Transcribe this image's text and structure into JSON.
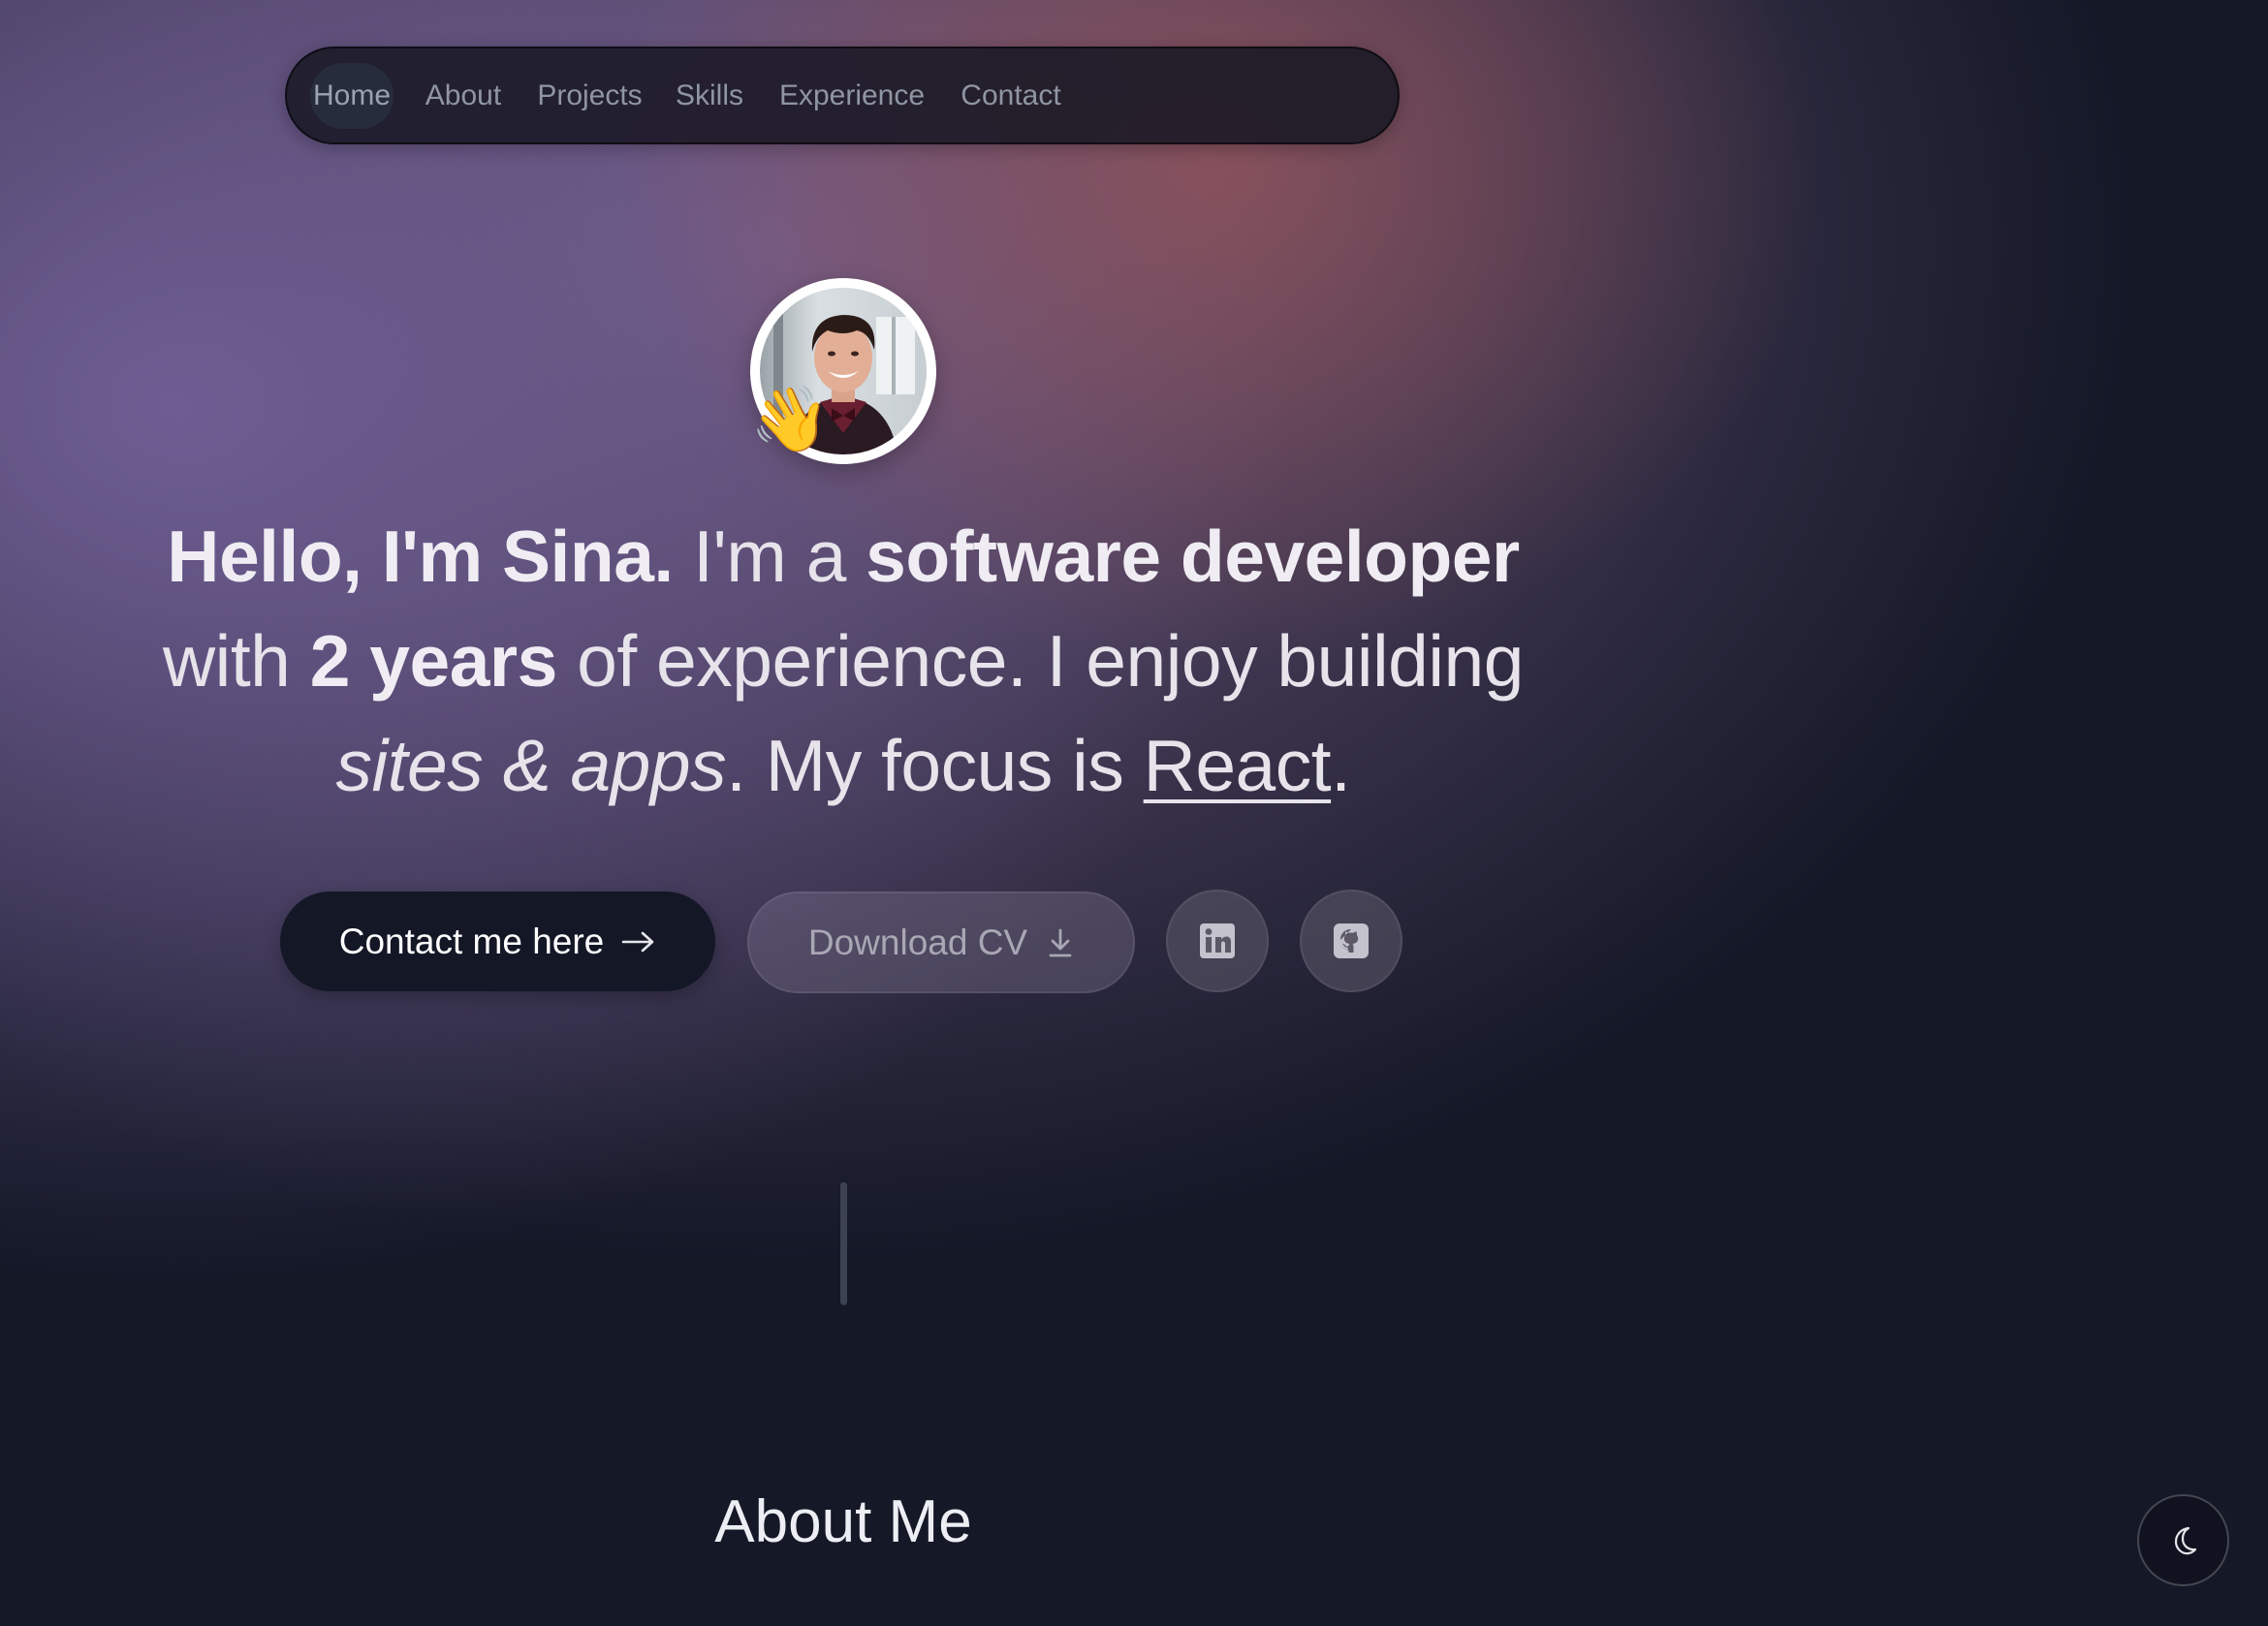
{
  "nav": {
    "items": [
      {
        "label": "Home",
        "active": true
      },
      {
        "label": "About",
        "active": false
      },
      {
        "label": "Projects",
        "active": false
      },
      {
        "label": "Skills",
        "active": false
      },
      {
        "label": "Experience",
        "active": false
      },
      {
        "label": "Contact",
        "active": false
      }
    ]
  },
  "hero": {
    "avatar_emoji": "👋",
    "headline": {
      "greeting": "Hello, I'm Sina.",
      "t1": " I'm a ",
      "role": "software developer",
      "t2": " with ",
      "years": "2 years",
      "t3": " of experience. I enjoy building ",
      "craft": "sites & apps",
      "t4": ". My focus is ",
      "focus": "React",
      "t5": "."
    },
    "buttons": {
      "contact_label": "Contact me here",
      "cv_label": "Download CV"
    },
    "social": [
      "linkedin-icon",
      "github-icon"
    ]
  },
  "about": {
    "title": "About Me"
  },
  "theme_toggle": {
    "icon": "moon-icon"
  },
  "colors": {
    "primary_button": "#131726",
    "background": "#141827"
  }
}
